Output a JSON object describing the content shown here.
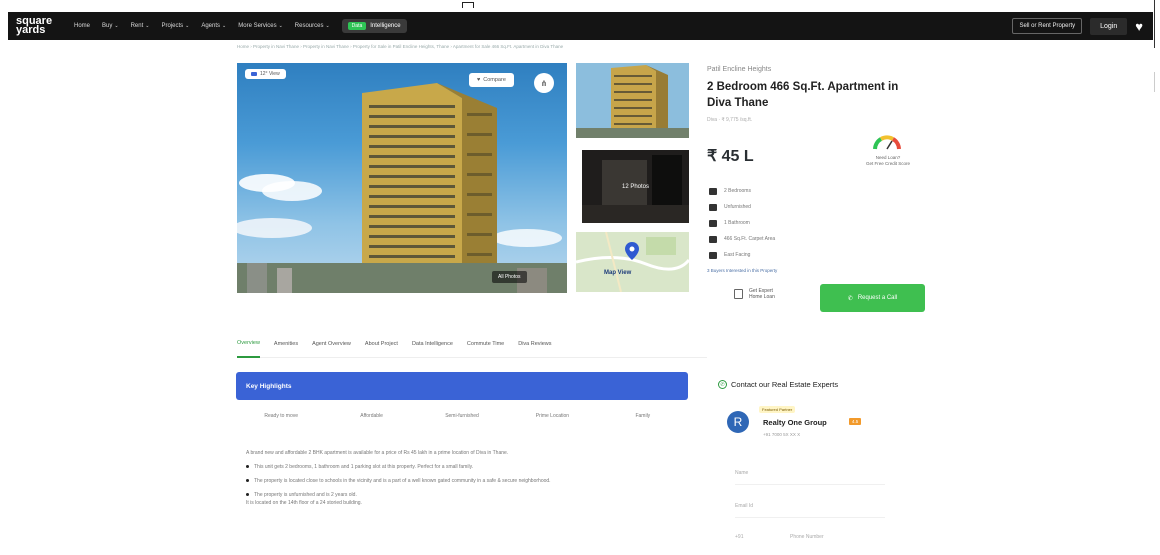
{
  "nav": {
    "logo_top": "square",
    "logo_bottom": "yards",
    "items": [
      {
        "label": "Home",
        "has_chevron": false
      },
      {
        "label": "Buy",
        "has_chevron": true
      },
      {
        "label": "Rent",
        "has_chevron": true
      },
      {
        "label": "Projects",
        "has_chevron": true
      },
      {
        "label": "Agents",
        "has_chevron": true
      },
      {
        "label": "More Services",
        "has_chevron": true
      },
      {
        "label": "Resources",
        "has_chevron": true
      }
    ],
    "intel_badge": "Data",
    "intel_label": "Intelligence",
    "sell_label": "Sell or Rent Property",
    "login_label": "Login",
    "heart_icon": "heart-icon"
  },
  "breadcrumb": "Home › Property in Navi Thane › Property in Navi Thane › Property for Sale in Patil Encline Heights, Thane › Apartment for Sale 466 Sq.Ft. Apartment in Diva Thane",
  "gallery": {
    "view_pill": "12° View",
    "compare_label": "Compare",
    "share_icon": "share-icon",
    "more_view_label": "All Photos",
    "photos_label": "12 Photos",
    "map_label": "Map View"
  },
  "details": {
    "project_name": "Patil Encline Heights",
    "title": "2 Bedroom 466 Sq.Ft. Apartment in Diva Thane",
    "location_line": "Diva · ₹ 9,775 /sq.ft.",
    "price": "₹ 45 L",
    "gauge_label_1": "Need Loan?",
    "gauge_label_2": "Get Free Credit Score",
    "features": [
      "2 Bedrooms",
      "Unfurnished",
      "1 Bathroom",
      "466 Sq.Ft. Carpet Area",
      "East Facing"
    ],
    "interest_line": "3 Buyers Interested in this Property",
    "expert_line_1": "Get Expert",
    "expert_line_2": "Home Loan",
    "call_label": "Request a Call"
  },
  "tabs": [
    {
      "label": "Overview",
      "active": true
    },
    {
      "label": "Amenities",
      "active": false
    },
    {
      "label": "Agent Overview",
      "active": false
    },
    {
      "label": "About Project",
      "active": false
    },
    {
      "label": "Data Intelligence",
      "active": false
    },
    {
      "label": "Commute Time",
      "active": false
    },
    {
      "label": "Diva Reviews",
      "active": false
    }
  ],
  "highlights": {
    "title": "Key Highlights",
    "chips": [
      "Ready to move",
      "Affordable",
      "Semi-furnished",
      "Prime Location",
      "Family"
    ],
    "intro": "A brand new and affordable 2 BHK apartment is available for a price of Rs 45 lakh in a prime location of Diva in Thane.",
    "bullets": [
      "This unit gets 2 bedrooms, 1 bathroom and 1 parking slot at this property. Perfect for a small family.",
      "The property is located close to schools in the vicinity and is a part of a well known gated community in a safe & secure neighborhood.",
      "The property is unfurnished and is 2 years old."
    ],
    "footer": "It is located on the 14th floor of a 24 storied building."
  },
  "contact": {
    "title": "Contact our Real Estate Experts",
    "featured_badge": "Featured Partner",
    "avatar_letter": "R",
    "agent_name": "Realty One Group",
    "rera_badge": "4.5",
    "agent_phone": "+91 7000 5X XX X",
    "fields": [
      "Name",
      "Email Id",
      "+91",
      "Phone Number"
    ]
  }
}
